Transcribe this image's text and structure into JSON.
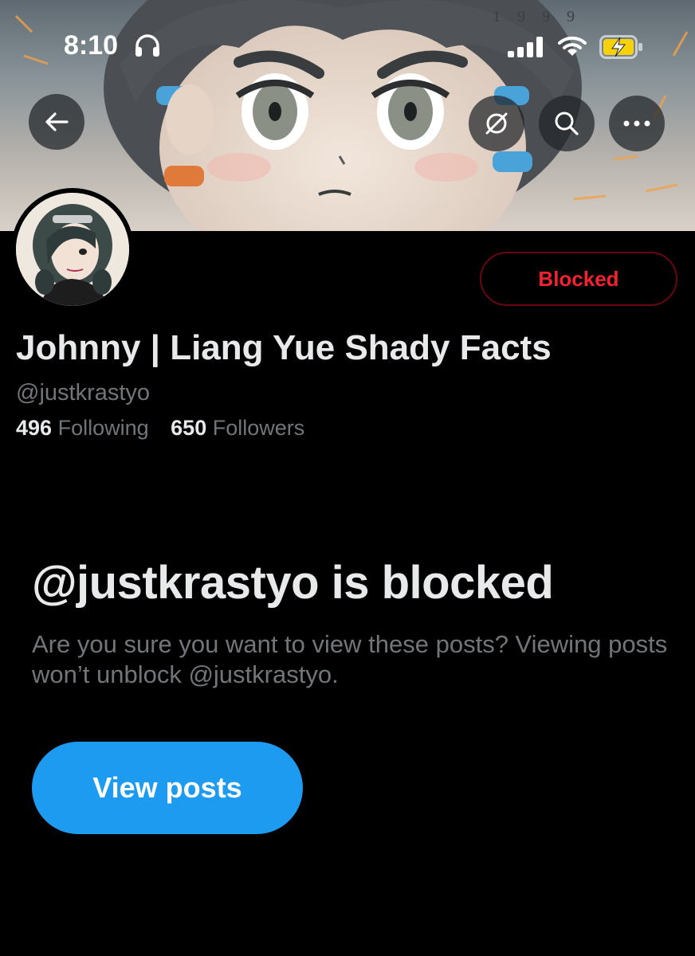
{
  "status_bar": {
    "time": "8:10",
    "headphones_icon": "headphones-icon",
    "signal_icon": "cellular-signal-icon",
    "wifi_icon": "wifi-icon",
    "battery_icon": "battery-charging-icon",
    "battery_color": "#f5d20a"
  },
  "banner": {
    "year_text": "1 9 9 9"
  },
  "header_actions": {
    "back_icon": "arrow-left-icon",
    "translate_icon": "translate-icon",
    "search_icon": "search-icon",
    "more_icon": "more-horizontal-icon"
  },
  "profile": {
    "display_name": "Johnny | Liang Yue Shady Facts",
    "handle": "@justkrastyo",
    "following_count": "496",
    "following_label": "Following",
    "followers_count": "650",
    "followers_label": "Followers",
    "blocked_button_label": "Blocked"
  },
  "blocked_notice": {
    "title": "@justkrastyo is blocked",
    "description": "Are you sure you want to view these posts? Viewing posts won’t unblock @justkrastyo.",
    "view_posts_label": "View posts"
  },
  "colors": {
    "background": "#000000",
    "primary_text": "#e7e9ea",
    "secondary_text": "#71767b",
    "accent_blue": "#1d9bf0",
    "blocked_red": "#f4212e",
    "blocked_border": "#67070f"
  }
}
